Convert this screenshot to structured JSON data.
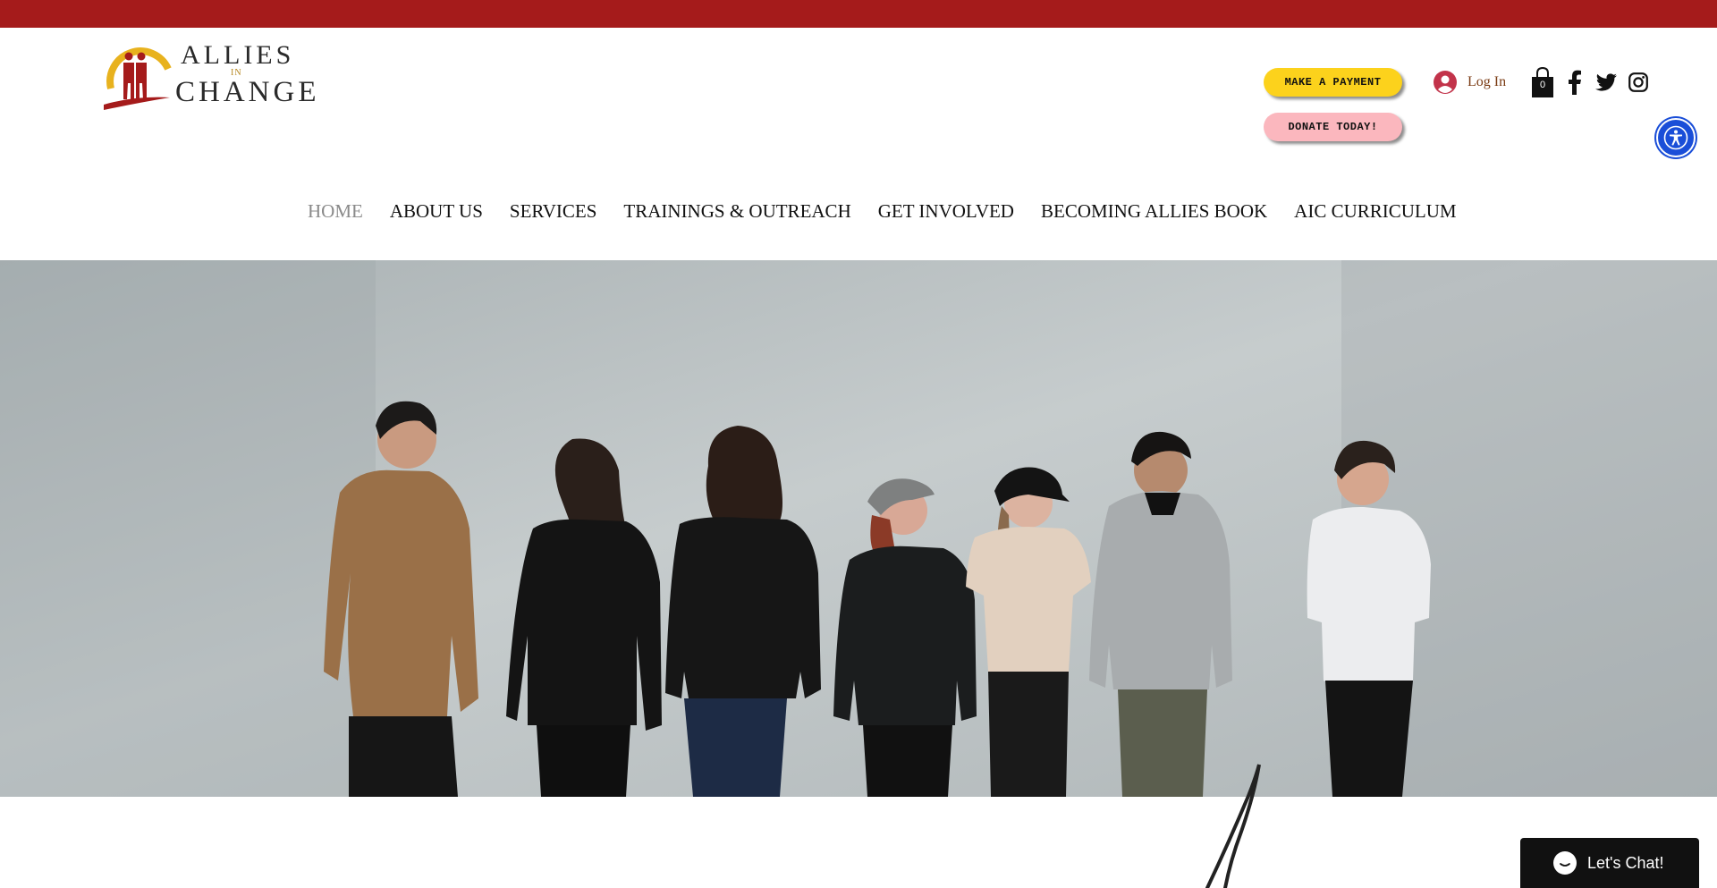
{
  "colors": {
    "top_bar": "#a51b1b",
    "pay_button": "#fcd21c",
    "donate_button": "#fbb7be",
    "login_text": "#7a3a12",
    "login_avatar": "#c2334a",
    "nav_active": "#8a8a8a",
    "nav_default": "#111111",
    "accessibility": "#1a4ed8",
    "chat": "#111111",
    "logo_red": "#a51b1b",
    "logo_gold": "#e8b21e"
  },
  "logo": {
    "line1": "ALLIES",
    "line2": "IN",
    "line3": "CHANGE",
    "icon": "two-figures-sun-icon"
  },
  "header": {
    "pay_label": "MAKE A PAYMENT",
    "donate_label": "DONATE TODAY!",
    "login_label": "Log In",
    "cart_count": "0",
    "icons": [
      "user-avatar-icon",
      "shopping-bag-icon",
      "facebook-icon",
      "twitter-icon",
      "instagram-icon",
      "accessibility-icon"
    ]
  },
  "nav": {
    "items": [
      {
        "label": "HOME",
        "active": true
      },
      {
        "label": "ABOUT US",
        "active": false
      },
      {
        "label": "SERVICES",
        "active": false
      },
      {
        "label": "TRAININGS & OUTREACH",
        "active": false
      },
      {
        "label": "GET INVOLVED",
        "active": false
      },
      {
        "label": "BECOMING ALLIES BOOK",
        "active": false
      },
      {
        "label": "AIC CURRICULUM",
        "active": false
      }
    ]
  },
  "hero": {
    "people_count": 7
  },
  "chat": {
    "label": "Let's Chat!",
    "icon": "chat-bubble-icon"
  }
}
